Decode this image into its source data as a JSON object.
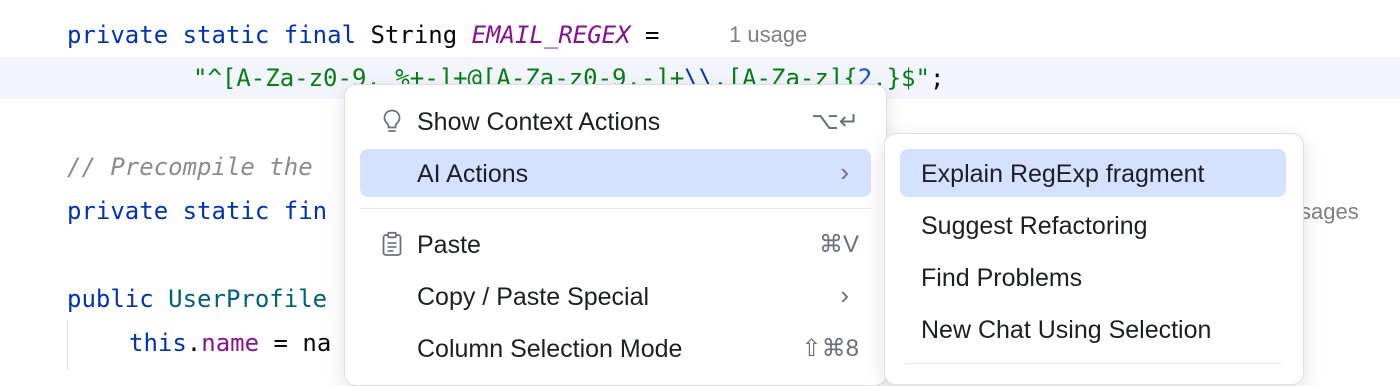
{
  "editor": {
    "line1": {
      "kw1": "private",
      "kw2": "static",
      "kw3": "final",
      "type": "String",
      "name": "EMAIL_REGEX",
      "op": "=",
      "usage": "1 usage"
    },
    "line2": {
      "s1": "\"^[A-Za-z0-9._%+-]+@[A-Za-z0-9.-]+",
      "s2": "\\\\.",
      "s3": "[A-Za-z]{",
      "n1": "2",
      "s4": ",}$\"",
      "semi": ";"
    },
    "line3": {
      "comment": "// Precompile the"
    },
    "line4": {
      "kw1": "private",
      "kw2": "static",
      "partial": "fin",
      "usage_suffix": "sages"
    },
    "line5": {
      "kw": "public",
      "cls": "UserProfile"
    },
    "line6": {
      "kw": "this",
      "dot": ".",
      "field": "name",
      "rest": " = na"
    }
  },
  "context_menu": {
    "items": [
      {
        "label": "Show Context Actions",
        "shortcut": "⌥↵",
        "icon": "lightbulb-icon"
      },
      {
        "label": "AI Actions",
        "submenu_arrow": "›"
      },
      {
        "label": "Paste",
        "shortcut": "⌘V",
        "icon": "clipboard-icon"
      },
      {
        "label": "Copy / Paste Special",
        "submenu_arrow": "›"
      },
      {
        "label": "Column Selection Mode",
        "shortcut": "⇧⌘8"
      }
    ]
  },
  "ai_submenu": {
    "items": [
      {
        "label": "Explain RegExp fragment"
      },
      {
        "label": "Suggest Refactoring"
      },
      {
        "label": "Find Problems"
      },
      {
        "label": "New Chat Using Selection"
      }
    ]
  },
  "colors": {
    "keyword": "#0033b3",
    "constant": "#871094",
    "string": "#067d17",
    "selection": "#d4e2ff",
    "current_line": "#f2f5fb"
  }
}
